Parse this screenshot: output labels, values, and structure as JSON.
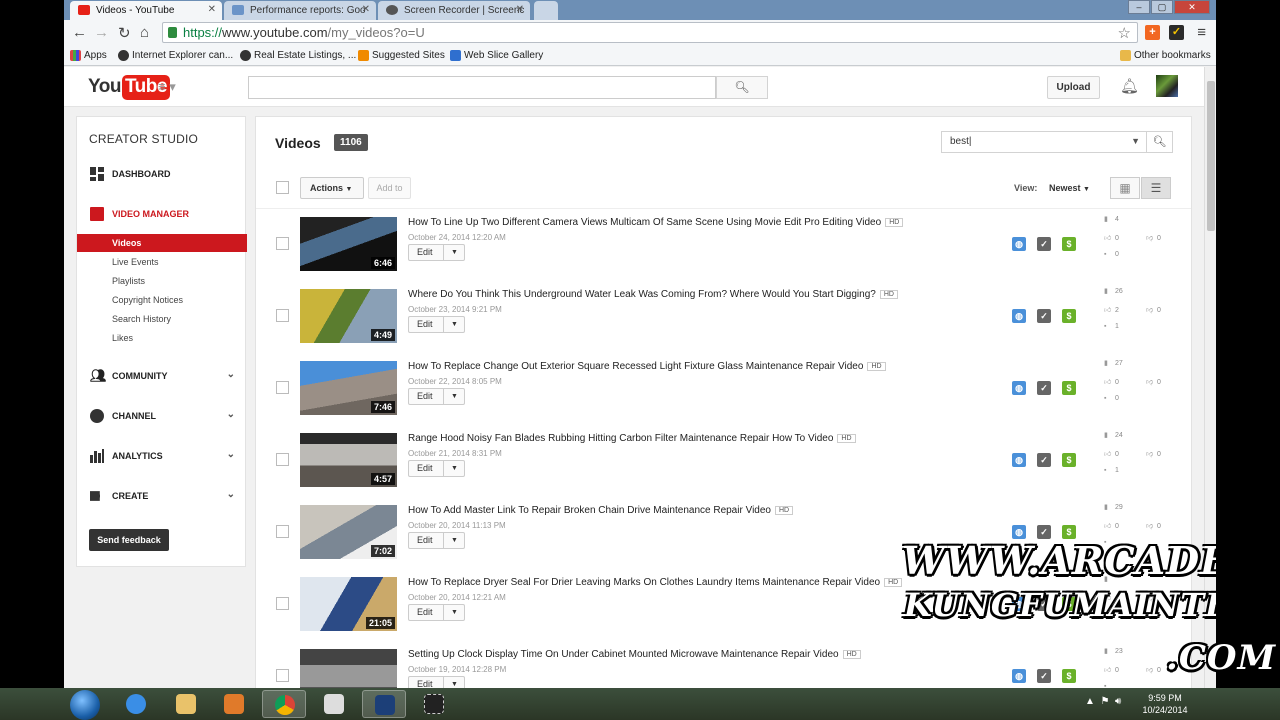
{
  "browser": {
    "tabs": [
      {
        "title": "Videos - YouTube",
        "active": true,
        "icon": "youtube-favicon"
      },
      {
        "title": "Performance reports: Goo",
        "active": false,
        "icon": "doc-favicon"
      },
      {
        "title": "Screen Recorder | Screenc",
        "active": false,
        "icon": "screencast-favicon"
      }
    ],
    "url_scheme": "https://",
    "url_host": "www.youtube.com",
    "url_path": "/my_videos?o=U",
    "bookmarks": [
      {
        "label": "Apps",
        "icon": "apps-grid-icon"
      },
      {
        "label": "Internet Explorer can...",
        "icon": "ie-icon"
      },
      {
        "label": "Real Estate Listings, ...",
        "icon": "ie-icon"
      },
      {
        "label": "Suggested Sites",
        "icon": "suggested-sites-icon"
      },
      {
        "label": "Web Slice Gallery",
        "icon": "web-slice-icon"
      }
    ],
    "other_bookmarks": "Other bookmarks"
  },
  "header": {
    "logo_you": "You",
    "logo_tube": "Tube",
    "search_value": "",
    "upload_label": "Upload"
  },
  "sidebar": {
    "title": "CREATOR STUDIO",
    "dashboard": "DASHBOARD",
    "video_manager": "VIDEO MANAGER",
    "sub_items": [
      "Videos",
      "Live Events",
      "Playlists",
      "Copyright Notices",
      "Search History",
      "Likes"
    ],
    "community": "COMMUNITY",
    "channel": "CHANNEL",
    "analytics": "ANALYTICS",
    "create": "CREATE",
    "feedback": "Send feedback"
  },
  "main": {
    "title": "Videos",
    "count": "1106",
    "filter_value": "best",
    "actions_label": "Actions",
    "add_to_label": "Add to",
    "view_label": "View:",
    "sort_label": "Newest",
    "videos": [
      {
        "title": "How To Line Up Two Different Camera Views Multicam Of Same Scene Using Movie Edit Pro Editing Video",
        "hd": "HD",
        "date": "October 24, 2014 12:20 AM",
        "duration": "6:46",
        "views": "4",
        "likes": "0",
        "dislikes": "0",
        "comments": "0"
      },
      {
        "title": "Where Do You Think This Underground Water Leak Was Coming From? Where Would You Start Digging?",
        "hd": "HD",
        "date": "October 23, 2014 9:21 PM",
        "duration": "4:49",
        "views": "26",
        "likes": "2",
        "dislikes": "0",
        "comments": "1"
      },
      {
        "title": "How To Replace Change Out Exterior Square Recessed Light Fixture Glass Maintenance Repair Video",
        "hd": "HD",
        "date": "October 22, 2014 8:05 PM",
        "duration": "7:46",
        "views": "27",
        "likes": "0",
        "dislikes": "0",
        "comments": "0"
      },
      {
        "title": "Range Hood Noisy Fan Blades Rubbing Hitting Carbon Filter Maintenance Repair How To Video",
        "hd": "HD",
        "date": "October 21, 2014 8:31 PM",
        "duration": "4:57",
        "views": "24",
        "likes": "0",
        "dislikes": "0",
        "comments": "1"
      },
      {
        "title": "How To Add Master Link To Repair Broken Chain Drive Maintenance Repair Video",
        "hd": "HD",
        "date": "October 20, 2014 11:13 PM",
        "duration": "7:02",
        "views": "29",
        "likes": "0",
        "dislikes": "0",
        "comments": ""
      },
      {
        "title": "How To Replace Dryer Seal For Drier Leaving Marks On Clothes Laundry Items Maintenance Repair Video",
        "hd": "HD",
        "date": "October 20, 2014 12:21 AM",
        "duration": "21:05",
        "views": "",
        "likes": "",
        "dislikes": "",
        "comments": ""
      },
      {
        "title": "Setting Up Clock Display Time On Under Cabinet Mounted Microwave Maintenance Repair Video",
        "hd": "HD",
        "date": "October 19, 2014 12:28 PM",
        "duration": "",
        "views": "23",
        "likes": "0",
        "dislikes": "0",
        "comments": ""
      }
    ],
    "edit_label": "Edit"
  },
  "watermark": {
    "line1": "WWW.ARCADE",
    "line2": "KUNGFUMAINTENANCE",
    "line3": ".COM"
  },
  "taskbar": {
    "time": "9:59 PM",
    "date": "10/24/2014"
  },
  "colors": {
    "youtube_red": "#cc181e",
    "status_globe": "#4a90d9",
    "status_monetized": "#6ab12a"
  }
}
